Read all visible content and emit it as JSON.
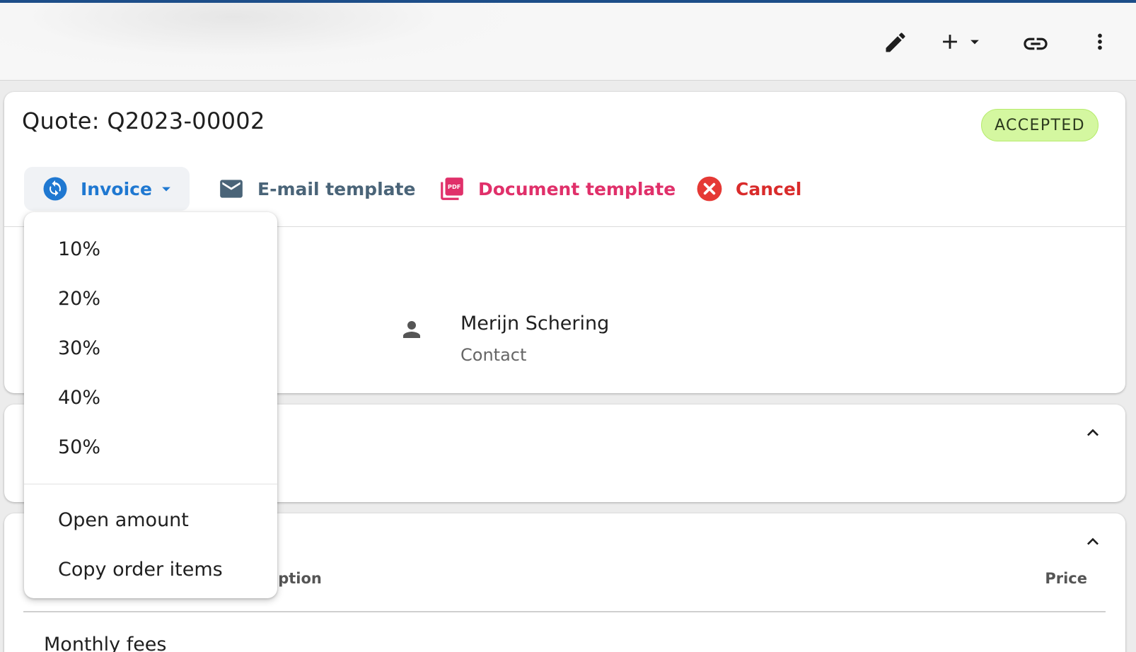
{
  "toolbar": {
    "icons": [
      "pencil-icon",
      "plus-icon",
      "caret-down-icon",
      "link-icon",
      "more-vert-icon"
    ]
  },
  "quote": {
    "title": "Quote: Q2023-00002",
    "status": "ACCEPTED",
    "status_colors": {
      "bg": "#d4f7a0",
      "border": "#b7ec6e"
    }
  },
  "actions": {
    "invoice": "Invoice",
    "email_template": "E-mail template",
    "document_template": "Document template",
    "cancel": "Cancel"
  },
  "contact": {
    "name": "Merijn Schering",
    "label": "Contact"
  },
  "invoice_menu": {
    "percentages": [
      "10%",
      "20%",
      "30%",
      "40%",
      "50%"
    ],
    "open_amount": "Open amount",
    "copy_order_items": "Copy order items"
  },
  "items_table": {
    "description_header": "iption",
    "price_header": "Price",
    "first_row": "Monthly fees"
  },
  "colors": {
    "accent_blue": "#1f78d1",
    "pdf_pink": "#e0306a",
    "cancel_red": "#d92b2b",
    "top_bar": "#1d4e89"
  }
}
